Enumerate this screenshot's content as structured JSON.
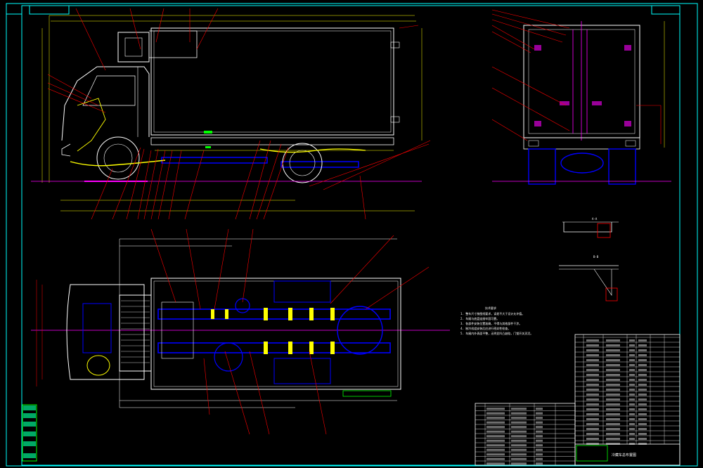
{
  "drawing": {
    "title_block_name": "冷藏车总布置图",
    "section_label_a": "A-A",
    "section_label_b": "B-B",
    "notes_heading": "技术要求",
    "notes": [
      "1. 整车尺寸按图纸要求，误差不大于设计允许值。",
      "2. 车厢与底盘连接牢固可靠。",
      "3. 各部件安装位置准确，不得与其他部件干涉。",
      "4. 制冷机组安装后应进行密封性检查。",
      "5. 车厢内外表面平整，无明显凹凸缺陷，门锁开关灵活。"
    ]
  },
  "colors": {
    "background": "#000000",
    "outline": "#ffffff",
    "frame_border": "#00ffff",
    "leader": "#ff0000",
    "chassis": "#0000ff",
    "centerline": "#ff00ff",
    "suspension": "#ffff00",
    "table_green": "#00ff00"
  },
  "left_stamp": [
    "设 计",
    "审 核",
    "工 艺",
    "标 准",
    "批 准"
  ]
}
